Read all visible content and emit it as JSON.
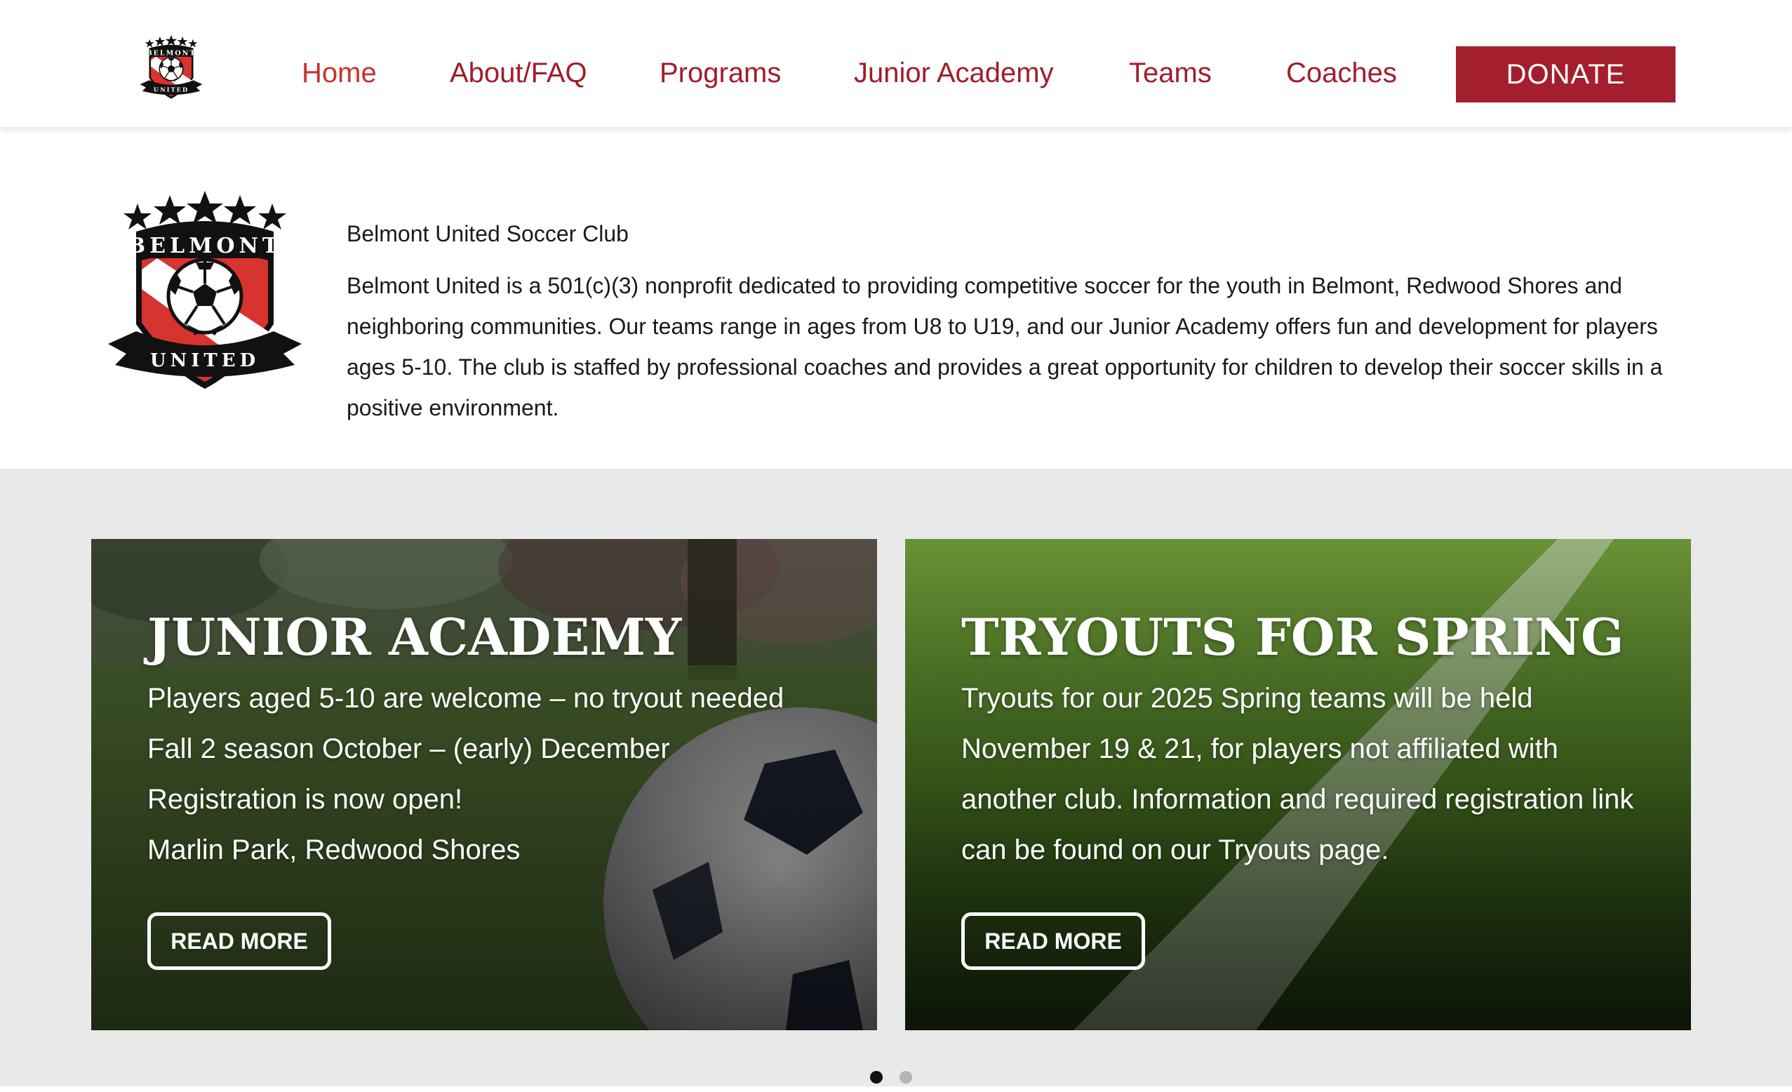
{
  "header": {
    "logo_alt": "Belmont United logo",
    "nav": [
      {
        "label": "Home",
        "active": true
      },
      {
        "label": "About/FAQ"
      },
      {
        "label": "Programs"
      },
      {
        "label": "Junior Academy"
      },
      {
        "label": "Teams"
      },
      {
        "label": "Coaches"
      }
    ],
    "donate_label": "DONATE"
  },
  "logo": {
    "top_text": "BELMONT",
    "bottom_text": "UNITED"
  },
  "intro": {
    "title": "Belmont United Soccer Club",
    "text": "Belmont United is a 501(c)(3) nonprofit dedicated to providing competitive soccer for the youth in Belmont, Redwood Shores and neighboring communities. Our teams range in ages from U8 to U19, and our Junior Academy offers fun and development for players ages 5-10. The club is staffed by professional coaches and provides a great opportunity for children to develop their soccer skills in a positive environment."
  },
  "cards": [
    {
      "title": "JUNIOR ACADEMY",
      "lines": [
        "Players aged 5-10 are welcome – no tryout needed",
        "Fall 2 season October – (early) December",
        "Registration is now open!",
        "Marlin Park, Redwood Shores"
      ],
      "button": "READ MORE"
    },
    {
      "title": "TRYOUTS FOR SPRING",
      "text": "Tryouts for our 2025 Spring teams will be held November 19 & 21, for players not affiliated with another club. Information and required registration link can be found on our Tryouts page.",
      "button": "READ MORE"
    }
  ],
  "slider": {
    "slide_count": 2,
    "active_index": 1
  },
  "colors": {
    "brand": "#a31f2e",
    "nav_active": "#c9302e",
    "section_bg": "#e9e9e9"
  }
}
